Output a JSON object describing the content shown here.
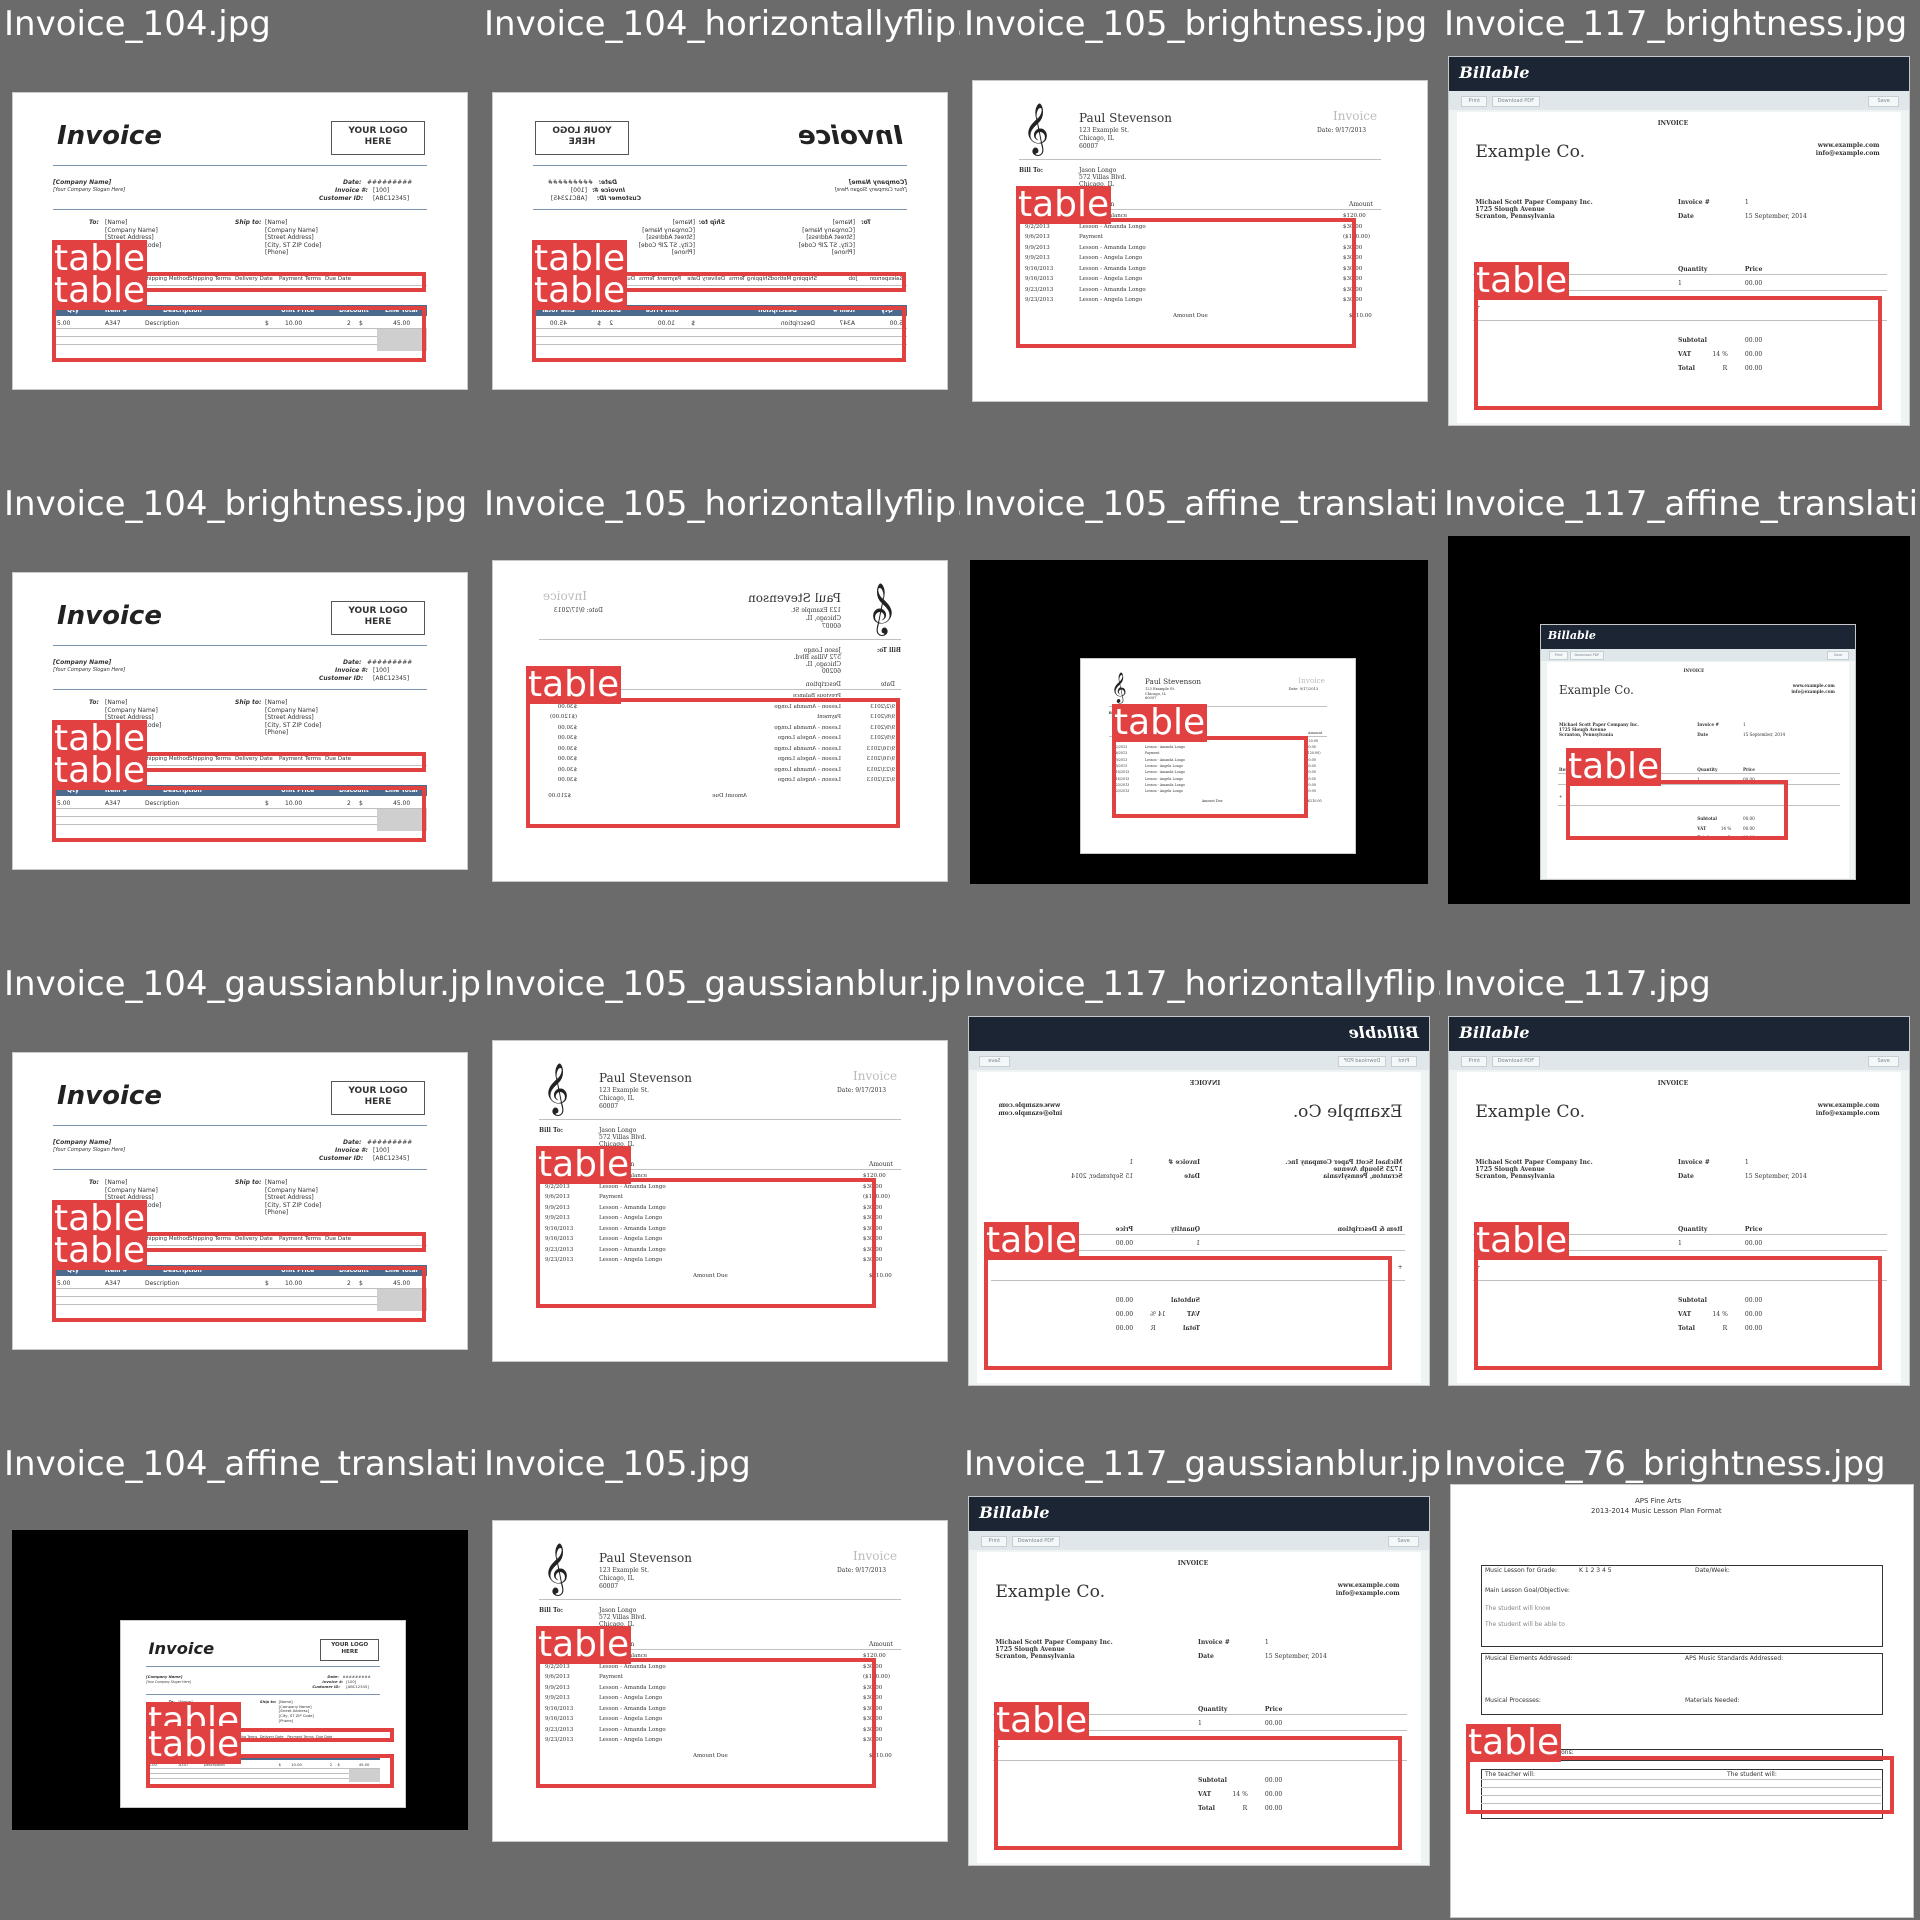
{
  "cells": [
    {
      "title": "Invoice_104.jpg"
    },
    {
      "title": "Invoice_104_horizontallyflip.jpg"
    },
    {
      "title": "Invoice_105_brightness.jpg"
    },
    {
      "title": "Invoice_117_brightness.jpg"
    },
    {
      "title": "Invoice_104_brightness.jpg"
    },
    {
      "title": "Invoice_105_horizontallyflip.jpg"
    },
    {
      "title": "Invoice_105_affine_translation.jpg"
    },
    {
      "title": "Invoice_117_affine_translation.jpg"
    },
    {
      "title": "Invoice_104_gaussianblur.jpg"
    },
    {
      "title": "Invoice_105_gaussianblur.jpg"
    },
    {
      "title": "Invoice_117_horizontallyflip.jpg"
    },
    {
      "title": "Invoice_117.jpg"
    },
    {
      "title": "Invoice_104_affine_translation.jpg"
    },
    {
      "title": "Invoice_105.jpg"
    },
    {
      "title": "Invoice_117_gaussianblur.jpg"
    },
    {
      "title": "Invoice_76_brightness.jpg"
    }
  ],
  "bbox_label": "table",
  "invoice104": {
    "title": "Invoice",
    "logo": "YOUR LOGO HERE",
    "company": "[Company Name]",
    "slogan": "[Your Company Slogan Here]",
    "date_label": "Date:",
    "date_value": "#########",
    "invoice_label": "Invoice #:",
    "invoice_value": "[100]",
    "customer_label": "Customer ID:",
    "customer_value": "[ABC12345]",
    "to_label": "To:",
    "ship_label": "Ship to:",
    "addr": [
      "[Name]",
      "[Company Name]",
      "[Street Address]",
      "[City, ST ZIP Code]",
      "[Phone]"
    ],
    "ship_cols": [
      "Salesperson",
      "Job",
      "Shipping Method",
      "Shipping Terms",
      "Delivery Date",
      "Payment Terms",
      "Due Date"
    ],
    "item_cols": [
      "Qty",
      "Item #",
      "Description",
      "Unit Price",
      "Discount",
      "Line Total"
    ],
    "row": [
      "5.00",
      "A347",
      "Description",
      "$",
      "10.00",
      "2",
      "$",
      "45.00"
    ]
  },
  "invoice105": {
    "name": "Paul Stevenson",
    "address": [
      "123 Example St.",
      "Chicago, IL",
      "60007"
    ],
    "heading": "Invoice",
    "date": "Date: 9/17/2013",
    "bill_to": "Bill To:",
    "bill_lines": [
      "Jason Longo",
      "572 Villas Blvd.",
      "Chicago, IL",
      "60200"
    ],
    "cols": [
      "Date",
      "Description",
      "Amount"
    ],
    "rows": [
      [
        "",
        "Previous Balance",
        "$120.00"
      ],
      [
        "9/2/2013",
        "Lesson - Amanda Longo",
        "$30.00"
      ],
      [
        "9/6/2013",
        "Payment",
        "($120.00)"
      ],
      [
        "9/9/2013",
        "Lesson - Amanda Longo",
        "$30.00"
      ],
      [
        "9/9/2013",
        "Lesson - Angela Longo",
        "$30.00"
      ],
      [
        "9/16/2013",
        "Lesson - Amanda Longo",
        "$30.00"
      ],
      [
        "9/16/2013",
        "Lesson - Angela Longo",
        "$30.00"
      ],
      [
        "9/23/2013",
        "Lesson - Amanda Longo",
        "$30.00"
      ],
      [
        "9/23/2013",
        "Lesson - Angela Longo",
        "$30.00"
      ]
    ],
    "amount_due": "Amount Due",
    "amount_due_value": "$210.00"
  },
  "invoice117": {
    "brand": "Billable",
    "buttons": [
      "Print",
      "Download PDF",
      "Save"
    ],
    "heading": "INVOICE",
    "company": "Example Co.",
    "web": "www.example.com",
    "email": "info@example.com",
    "client": [
      "Michael Scott Paper Company Inc.",
      "1725 Slough Avenue",
      "Scranton, Pennsylvania"
    ],
    "invoice_no_label": "Invoice #",
    "invoice_no": "1",
    "date_label": "Date",
    "date_value": "15 September, 2014",
    "cols": [
      "Item & Description",
      "Quantity",
      "Price"
    ],
    "qty": "1",
    "price": "00.00",
    "plus": "+",
    "subtotal_label": "Subtotal",
    "subtotal": "00.00",
    "vat_label": "VAT",
    "vat_rate": "14 %",
    "vat": "00.00",
    "total_label": "Total",
    "total_cur": "R",
    "total": "00.00"
  },
  "invoice76": {
    "org": "APS Fine Arts",
    "title": "2013-2014 Music Lesson Plan Format",
    "grade_label": "Music Lesson for Grade:",
    "grades": "K  1  2  3  4  5",
    "date_week": "Date/Week:",
    "goal": "Main Lesson Goal/Objective:",
    "student1": "The student will know",
    "student2": "The student will be able to",
    "elements": "Musical Elements Addressed:",
    "standards": "APS Music Standards Addressed:",
    "processes": "Musical Processes:",
    "materials": "Materials Needed:",
    "cross": "Cross Curricular Connections:",
    "teacher": "The teacher will:",
    "studentwill": "The student will:"
  }
}
